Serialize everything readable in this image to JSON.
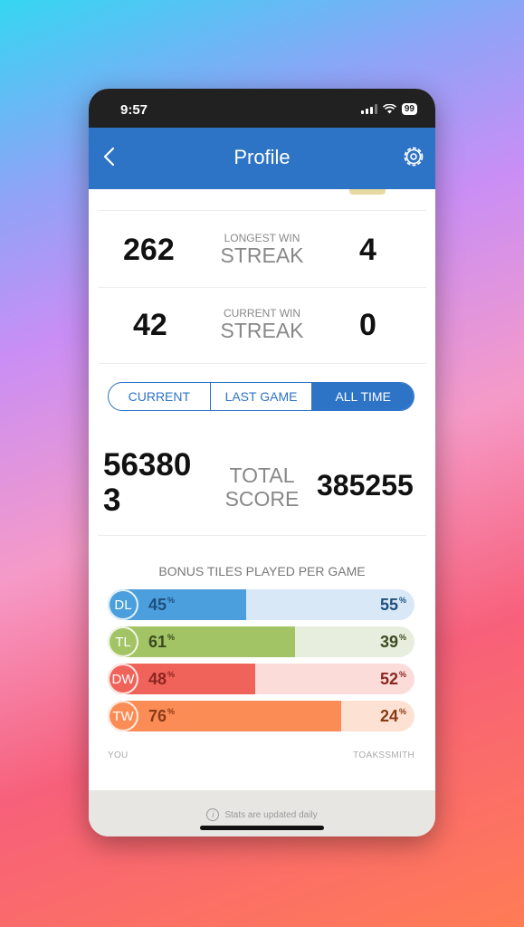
{
  "status": {
    "time": "9:57",
    "battery": "99"
  },
  "nav": {
    "title": "Profile"
  },
  "streaks": [
    {
      "you": "262",
      "label_small": "LONGEST WIN",
      "label_big": "STREAK",
      "opponent": "4"
    },
    {
      "you": "42",
      "label_small": "CURRENT WIN",
      "label_big": "STREAK",
      "opponent": "0"
    }
  ],
  "tabs": [
    "CURRENT",
    "LAST GAME",
    "ALL TIME"
  ],
  "active_tab": "ALL TIME",
  "score": {
    "you_line1": "56380",
    "you_line2": "3",
    "label_line1": "TOTAL",
    "label_line2": "SCORE",
    "opponent": "385255"
  },
  "bonus": {
    "title": "BONUS TILES PLAYED PER GAME",
    "rows": [
      {
        "code": "DL",
        "you": "45",
        "opponent": "55",
        "you_fraction": 0.45,
        "you_color": "#4a9fdc",
        "opp_bg": "#d8e8f6",
        "text_color": "#1f4f7e"
      },
      {
        "code": "TL",
        "you": "61",
        "opponent": "39",
        "you_fraction": 0.61,
        "you_color": "#a3c464",
        "opp_bg": "#e7eedd",
        "text_color": "#3c4a22"
      },
      {
        "code": "DW",
        "you": "48",
        "opponent": "52",
        "you_fraction": 0.48,
        "you_color": "#f0635a",
        "opp_bg": "#fbdcd9",
        "text_color": "#8a2620"
      },
      {
        "code": "TW",
        "you": "76",
        "opponent": "24",
        "you_fraction": 0.76,
        "you_color": "#fb8c55",
        "opp_bg": "#fde2d3",
        "text_color": "#8a3a17"
      }
    ],
    "pct_sign": "%",
    "you_label": "YOU",
    "opponent_label": "TOAKSSMITH"
  },
  "footer": {
    "text": "Stats are updated daily",
    "info_glyph": "i"
  }
}
